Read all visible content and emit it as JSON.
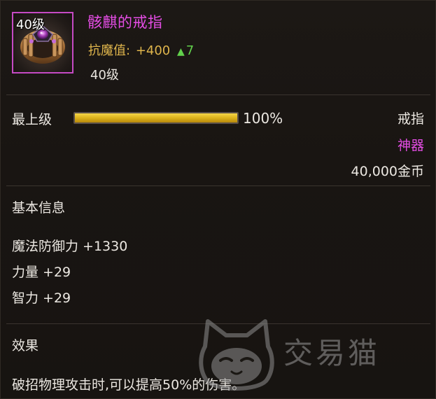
{
  "item": {
    "level_badge": "40级",
    "name": "骸麒的戒指",
    "stat_label": "抗魔值:",
    "stat_value": "+400",
    "stat_bonus": "7",
    "required_level": "40级"
  },
  "enhance": {
    "label": "最上级",
    "progress_percent": 100,
    "progress_text": "100%"
  },
  "meta": {
    "slot_type": "戒指",
    "rarity": "神器",
    "price": "40,000金币"
  },
  "basic_info": {
    "title": "基本信息",
    "attributes": [
      "魔法防御力 +1330",
      "力量 +29",
      "智力 +29"
    ]
  },
  "effect": {
    "title": "效果",
    "description": "破招物理攻击时,可以提高50%的伤害。"
  },
  "watermark": {
    "text": "交易猫"
  },
  "colors": {
    "rarity_purple": "#e54de5",
    "stat_gold": "#dfb54c",
    "bonus_green": "#62d14c",
    "progress_gold": "#dcb21b"
  },
  "icons": {
    "item_icon": "ring-icon",
    "bonus_arrow": "up-arrow-icon",
    "watermark_logo": "cat-logo-icon"
  }
}
